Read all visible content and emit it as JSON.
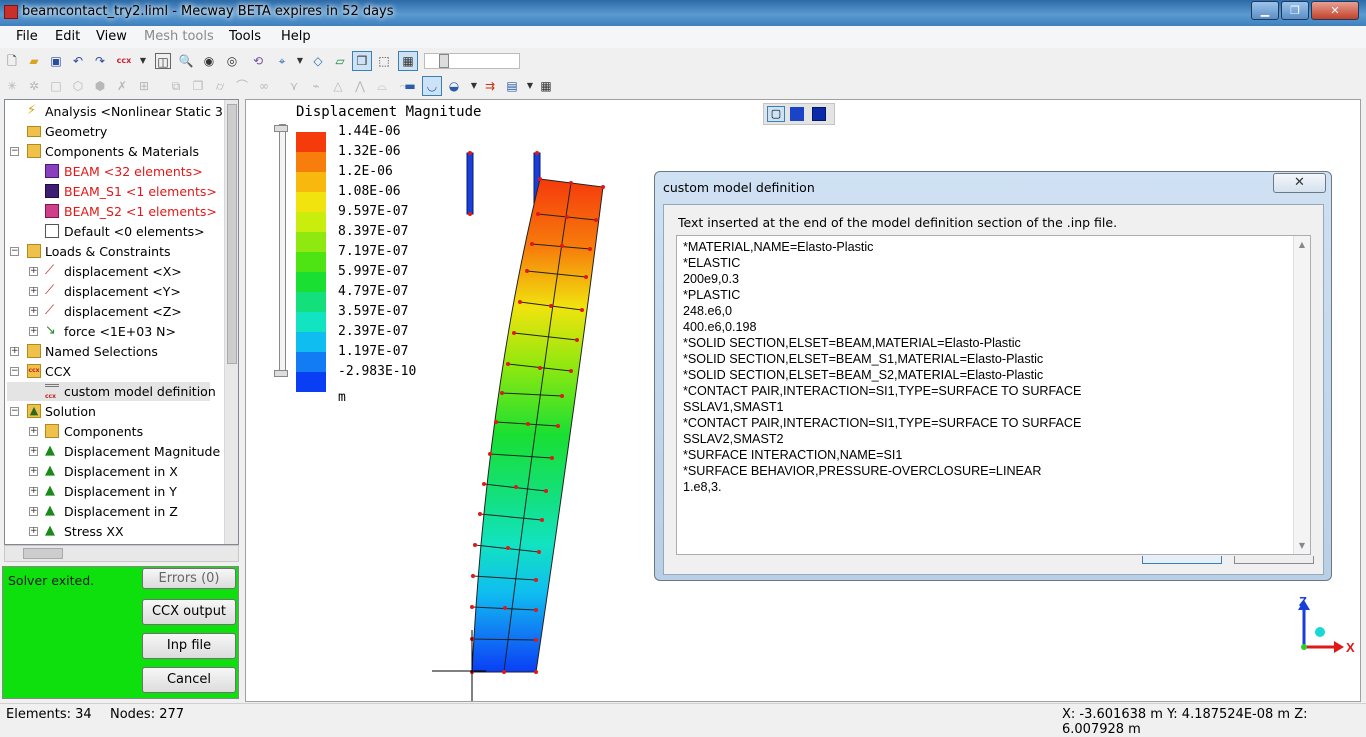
{
  "window": {
    "title": "beamcontact_try2.liml - Mecway BETA expires in 52 days",
    "min_label": "▁",
    "max_label": "❐",
    "close_label": "✕"
  },
  "menu": [
    "File",
    "Edit",
    "View",
    "Mesh tools",
    "Tools",
    "Help"
  ],
  "tree": {
    "analysis": "Analysis <Nonlinear Static 3D:",
    "geometry": "Geometry",
    "components": "Components & Materials",
    "beam": "BEAM <32 elements>",
    "beam_s1": "BEAM_S1 <1 elements>",
    "beam_s2": "BEAM_S2 <1 elements>",
    "default": "Default <0 elements>",
    "loads": "Loads & Constraints",
    "disp_x": "displacement <X>",
    "disp_y": "displacement <Y>",
    "disp_z": "displacement <Z>",
    "force": "force <1E+03 N>",
    "named": "Named Selections",
    "ccx": "CCX",
    "cmd": "custom model definition",
    "solution": "Solution",
    "sol_components": "Components",
    "sol_dispmag": "Displacement Magnitude",
    "sol_dx": "Displacement in X",
    "sol_dy": "Displacement in Y",
    "sol_dz": "Displacement in Z",
    "sol_sxx": "Stress XX"
  },
  "solver": {
    "status": "Solver exited.",
    "errors": "Errors (0)",
    "ccx_output": "CCX output",
    "inp_file": "Inp file",
    "cancel": "Cancel"
  },
  "legend": {
    "title": "Displacement Magnitude",
    "unit": "m",
    "values": [
      "1.44E-06",
      "1.32E-06",
      "1.2E-06",
      "1.08E-06",
      "9.597E-07",
      "8.397E-07",
      "7.197E-07",
      "5.997E-07",
      "4.797E-07",
      "3.597E-07",
      "2.397E-07",
      "1.197E-07",
      "-2.983E-10"
    ],
    "colors": [
      "#f53a0c",
      "#f77d0c",
      "#f8b80e",
      "#f1e30e",
      "#c9ee0e",
      "#8fe80f",
      "#4ee312",
      "#19df33",
      "#13e07b",
      "#12e3c0",
      "#0fbdf0",
      "#117cf4",
      "#0a3ef5"
    ]
  },
  "axes": {
    "z": "Z",
    "x": "X"
  },
  "dialog": {
    "title": "custom model definition",
    "close": "✕",
    "caption": "Text inserted at the end of the model definition section of the .inp file.",
    "text": "*MATERIAL,NAME=Elasto-Plastic\n*ELASTIC\n200e9,0.3\n*PLASTIC\n248.e6,0\n400.e6,0.198\n*SOLID SECTION,ELSET=BEAM,MATERIAL=Elasto-Plastic\n*SOLID SECTION,ELSET=BEAM_S1,MATERIAL=Elasto-Plastic\n*SOLID SECTION,ELSET=BEAM_S2,MATERIAL=Elasto-Plastic\n*CONTACT PAIR,INTERACTION=SI1,TYPE=SURFACE TO SURFACE\nSSLAV1,SMAST1\n*CONTACT PAIR,INTERACTION=SI1,TYPE=SURFACE TO SURFACE\nSSLAV2,SMAST2\n*SURFACE INTERACTION,NAME=SI1\n*SURFACE BEHAVIOR,PRESSURE-OVERCLOSURE=LINEAR\n1.e8,3."
  },
  "status": {
    "elements": "Elements:  34",
    "nodes": "Nodes: 277",
    "coords": "X: -3.601638 m Y: 4.187524E-08 m Z: 6.007928 m"
  }
}
